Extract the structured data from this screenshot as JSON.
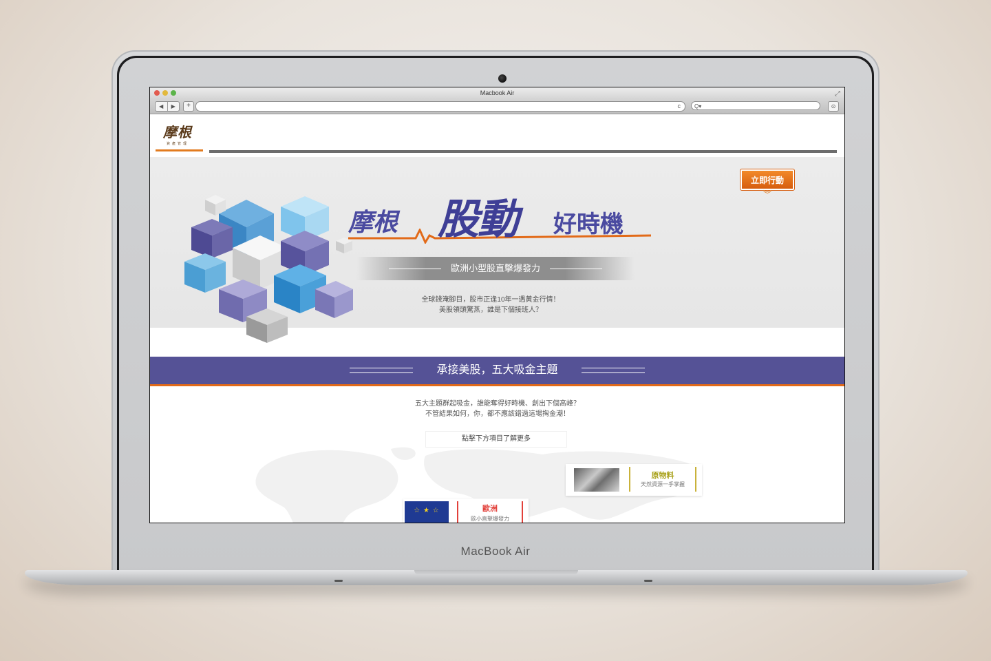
{
  "device": {
    "brand_label": "MacBook Air"
  },
  "browser": {
    "window_title": "Macbook Air",
    "back_icon": "◀",
    "forward_icon": "▶",
    "new_tab_icon": "+",
    "reload_icon": "c",
    "search_icon": "Q▾",
    "download_icon": "⊙",
    "fullscreen_icon": "⤢"
  },
  "header": {
    "logo_text": "摩根",
    "logo_subtext": "資產管理"
  },
  "hero": {
    "cta_label": "立即行動",
    "cta_arrow": "︾",
    "title_part1": "摩根",
    "title_part2": "股動",
    "title_part3": "好時機",
    "subtitle": "歐洲小型股直擊爆發力",
    "text_line1": "全球錢淹腳目，股市正逢10年一遇黃金行情！",
    "text_line2": "美股領頭驚蒸，誰是下個接班人？"
  },
  "band": {
    "label": "承接美股，五大吸金主題"
  },
  "intro": {
    "line1": "五大主題群起吸金，誰能奪得好時機、創出下個高峰？",
    "line2": "不管結果如何，你，都不應該錯過這場掏金潮！",
    "more_label": "點擊下方項目了解更多"
  },
  "cards": [
    {
      "name": "原物料",
      "desc": "天然資源一手掌握",
      "accent": "#c9b23a"
    },
    {
      "name": "歐洲",
      "desc": "歐小直擊爆發力",
      "accent": "#e2403a"
    }
  ],
  "colors": {
    "brand_orange": "#e27b1f",
    "brand_purple": "#555296",
    "title_blue": "#3f3f96"
  }
}
